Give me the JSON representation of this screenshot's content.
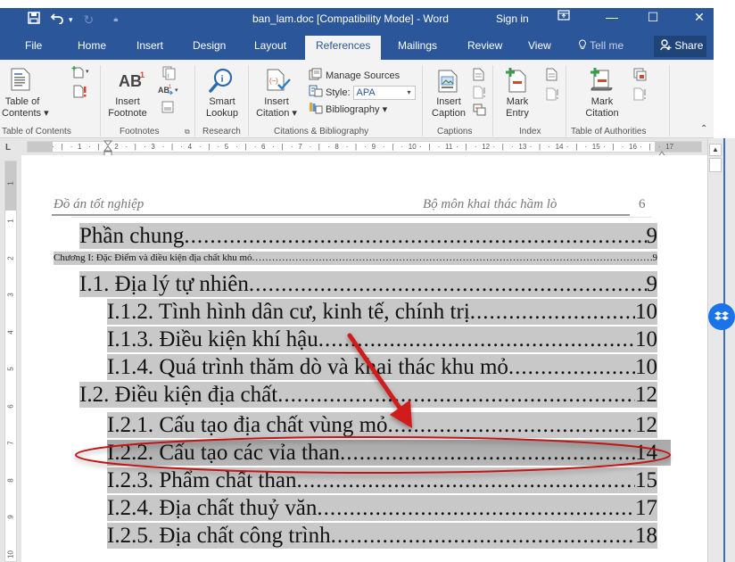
{
  "window": {
    "title": "ban_lam.doc [Compatibility Mode]  -  Word",
    "sign_in": "Sign in",
    "controls": {
      "ribbon_display": "▣",
      "minimize": "—",
      "maximize": "☐",
      "close": "✕"
    },
    "qat": {
      "save_icon": "save-icon",
      "undo_icon": "undo-icon",
      "redo_icon": "redo-icon",
      "customize_icon": "customize-qat-icon"
    }
  },
  "tabs": [
    {
      "label": "File"
    },
    {
      "label": "Home"
    },
    {
      "label": "Insert"
    },
    {
      "label": "Design"
    },
    {
      "label": "Layout"
    },
    {
      "label": "References",
      "active": true
    },
    {
      "label": "Mailings"
    },
    {
      "label": "Review"
    },
    {
      "label": "View"
    }
  ],
  "tell_me": "Tell me",
  "share": "Share",
  "ribbon": {
    "groups": {
      "toc": {
        "label": "Table of Contents",
        "toc_button": "Table of\nContents ▾",
        "toc_line1": "Table of",
        "toc_line2": "Contents ▾"
      },
      "footnotes": {
        "label": "Footnotes",
        "insert_footnote_line1": "Insert",
        "insert_footnote_line2": "Footnote"
      },
      "research": {
        "label": "Research",
        "smart_lookup_line1": "Smart",
        "smart_lookup_line2": "Lookup"
      },
      "citations": {
        "label": "Citations & Bibliography",
        "insert_citation_line1": "Insert",
        "insert_citation_line2": "Citation ▾",
        "manage_sources": "Manage Sources",
        "style_label": "Style:",
        "style_value": "APA",
        "bibliography": "Bibliography ▾"
      },
      "captions": {
        "label": "Captions",
        "insert_caption_line1": "Insert",
        "insert_caption_line2": "Caption"
      },
      "index": {
        "label": "Index",
        "mark_entry_line1": "Mark",
        "mark_entry_line2": "Entry"
      },
      "authorities": {
        "label": "Table of Authorities",
        "mark_citation_line1": "Mark",
        "mark_citation_line2": "Citation"
      }
    }
  },
  "ruler": {
    "horizontal_ticks": [
      "1",
      "2",
      "3",
      "4",
      "5",
      "6",
      "7",
      "8",
      "9",
      "10",
      "11",
      "12",
      "13",
      "14",
      "15",
      "16",
      "17"
    ],
    "vertical_ticks": [
      "1",
      "1",
      "2",
      "3",
      "4",
      "5",
      "6",
      "7",
      "8",
      "9",
      "10"
    ]
  },
  "document": {
    "header_left": "Đồ án tốt nghiệp",
    "header_right": "Bộ môn khai thác hầm lò",
    "header_page": "6",
    "toc": [
      {
        "text": "Phần chung",
        "page": "9",
        "level": 0
      },
      {
        "text": "Chương I: Đặc Điểm và điều kiện địa chất khu mỏ",
        "page": "9",
        "level": "chapter"
      },
      {
        "text": "I.1. Địa lý tự  nhiên",
        "page": "9",
        "level": 1
      },
      {
        "text": "I.1.2.  Tình hình dân cư, kinh tế, chính trị",
        "page": "10",
        "level": 2
      },
      {
        "text": "I.1.3. Điều kiện khí hậu",
        "page": "10",
        "level": 2
      },
      {
        "text": "I.1.4. Quá trình thăm dò và khai thác khu mỏ",
        "page": "10",
        "level": 2
      },
      {
        "text": "I.2. Điều kiện địa chất",
        "page": "12",
        "level": 1
      },
      {
        "text": "I.2.1. Cấu tạo địa chất vùng mỏ",
        "page": "12",
        "level": 2
      },
      {
        "text": "I.2.2. Cấu tạo các vỉa than",
        "page": "14",
        "level": 2,
        "highlighted": true
      },
      {
        "text": "I.2.3. Phẩm chất than",
        "page": "15",
        "level": 2
      },
      {
        "text": "I.2.4. Địa chất thuỷ văn",
        "page": "17",
        "level": 2
      },
      {
        "text": "I.2.5. Địa chất công trình",
        "page": "18",
        "level": 2
      }
    ]
  },
  "annotation": {
    "color": "#d11a1a",
    "arrow_target": "I.2.2. Cấu tạo các vỉa than"
  },
  "colors": {
    "word_blue": "#2b579a",
    "share_bg": "#1f4478",
    "ribbon_bg": "#f3f3f3",
    "toc_field_shading": "#c8c8c8"
  }
}
